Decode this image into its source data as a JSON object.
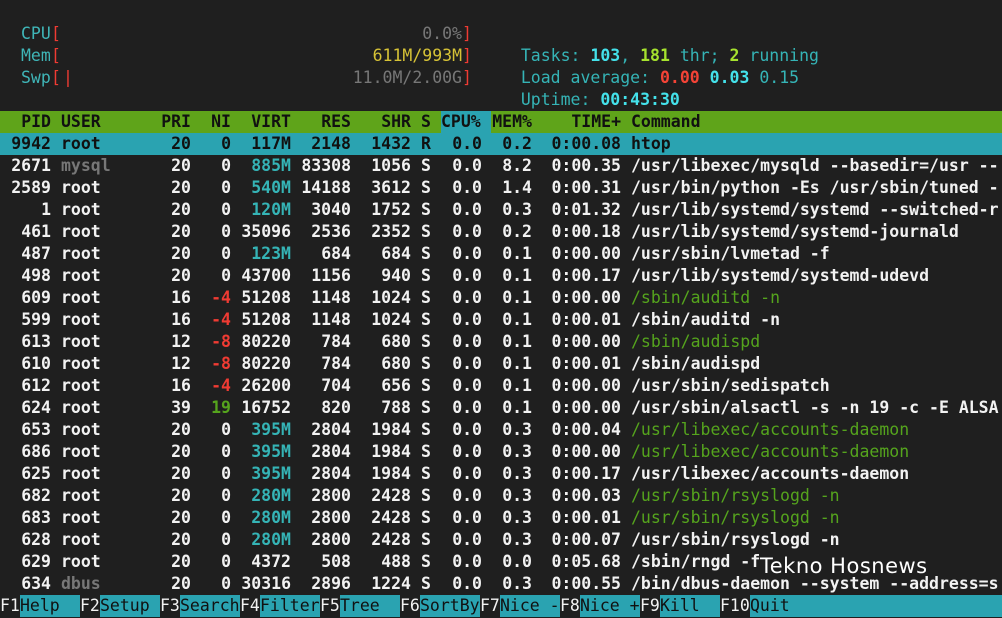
{
  "meters": {
    "cpu": {
      "label": "CPU",
      "bars": "",
      "value": "0.0%"
    },
    "mem": {
      "label": "Mem",
      "bars": "||||||||||||||||||||||||||||||||||||||",
      "value": "611M/993M"
    },
    "swp": {
      "label": "Swp",
      "bars": "|",
      "value": "11.0M/2.00G"
    }
  },
  "summary": {
    "tasks_label": "Tasks: ",
    "tasks": "103",
    "thr": "181",
    "thr_label": " thr; ",
    "running": "2",
    "running_label": " running",
    "load_label": "Load average: ",
    "load1": "0.00",
    "load5": "0.03",
    "load15": "0.15",
    "uptime_label": "Uptime: ",
    "uptime": "00:43:30"
  },
  "columns": [
    "PID",
    "USER",
    "PRI",
    "NI",
    "VIRT",
    "RES",
    "SHR",
    "S",
    "CPU%",
    "MEM%",
    "TIME+",
    "Command"
  ],
  "processes": [
    {
      "pid": "9942",
      "user": "root",
      "pri": "20",
      "ni": "0",
      "virt": "117M",
      "res": "2148",
      "shr": "1432",
      "s": "R",
      "cpu": "0.0",
      "mem": "0.2",
      "time": "0:00.08",
      "cmd": "htop"
    },
    {
      "pid": "2671",
      "user": "mysql",
      "pri": "20",
      "ni": "0",
      "virt": "885M",
      "res": "83308",
      "shr": "1056",
      "s": "S",
      "cpu": "0.0",
      "mem": "8.2",
      "time": "0:00.35",
      "cmd": "/usr/libexec/mysqld --basedir=/usr --"
    },
    {
      "pid": "2589",
      "user": "root",
      "pri": "20",
      "ni": "0",
      "virt": "540M",
      "res": "14188",
      "shr": "3612",
      "s": "S",
      "cpu": "0.0",
      "mem": "1.4",
      "time": "0:00.31",
      "cmd": "/usr/bin/python -Es /usr/sbin/tuned -"
    },
    {
      "pid": "1",
      "user": "root",
      "pri": "20",
      "ni": "0",
      "virt": "120M",
      "res": "3040",
      "shr": "1752",
      "s": "S",
      "cpu": "0.0",
      "mem": "0.3",
      "time": "0:01.32",
      "cmd": "/usr/lib/systemd/systemd --switched-r"
    },
    {
      "pid": "461",
      "user": "root",
      "pri": "20",
      "ni": "0",
      "virt": "35096",
      "res": "2536",
      "shr": "2352",
      "s": "S",
      "cpu": "0.0",
      "mem": "0.2",
      "time": "0:00.18",
      "cmd": "/usr/lib/systemd/systemd-journald"
    },
    {
      "pid": "487",
      "user": "root",
      "pri": "20",
      "ni": "0",
      "virt": "123M",
      "res": "684",
      "shr": "684",
      "s": "S",
      "cpu": "0.0",
      "mem": "0.1",
      "time": "0:00.00",
      "cmd": "/usr/sbin/lvmetad -f"
    },
    {
      "pid": "498",
      "user": "root",
      "pri": "20",
      "ni": "0",
      "virt": "43700",
      "res": "1156",
      "shr": "940",
      "s": "S",
      "cpu": "0.0",
      "mem": "0.1",
      "time": "0:00.17",
      "cmd": "/usr/lib/systemd/systemd-udevd"
    },
    {
      "pid": "609",
      "user": "root",
      "pri": "16",
      "ni": "-4",
      "virt": "51208",
      "res": "1148",
      "shr": "1024",
      "s": "S",
      "cpu": "0.0",
      "mem": "0.1",
      "time": "0:00.00",
      "cmd": "/sbin/auditd -n"
    },
    {
      "pid": "599",
      "user": "root",
      "pri": "16",
      "ni": "-4",
      "virt": "51208",
      "res": "1148",
      "shr": "1024",
      "s": "S",
      "cpu": "0.0",
      "mem": "0.1",
      "time": "0:00.01",
      "cmd": "/sbin/auditd -n"
    },
    {
      "pid": "613",
      "user": "root",
      "pri": "12",
      "ni": "-8",
      "virt": "80220",
      "res": "784",
      "shr": "680",
      "s": "S",
      "cpu": "0.0",
      "mem": "0.1",
      "time": "0:00.00",
      "cmd": "/sbin/audispd"
    },
    {
      "pid": "610",
      "user": "root",
      "pri": "12",
      "ni": "-8",
      "virt": "80220",
      "res": "784",
      "shr": "680",
      "s": "S",
      "cpu": "0.0",
      "mem": "0.1",
      "time": "0:00.01",
      "cmd": "/sbin/audispd"
    },
    {
      "pid": "612",
      "user": "root",
      "pri": "16",
      "ni": "-4",
      "virt": "26200",
      "res": "704",
      "shr": "656",
      "s": "S",
      "cpu": "0.0",
      "mem": "0.1",
      "time": "0:00.00",
      "cmd": "/usr/sbin/sedispatch"
    },
    {
      "pid": "624",
      "user": "root",
      "pri": "39",
      "ni": "19",
      "virt": "16752",
      "res": "820",
      "shr": "788",
      "s": "S",
      "cpu": "0.0",
      "mem": "0.1",
      "time": "0:00.00",
      "cmd": "/usr/sbin/alsactl -s -n 19 -c -E ALSA"
    },
    {
      "pid": "653",
      "user": "root",
      "pri": "20",
      "ni": "0",
      "virt": "395M",
      "res": "2804",
      "shr": "1984",
      "s": "S",
      "cpu": "0.0",
      "mem": "0.3",
      "time": "0:00.04",
      "cmd": "/usr/libexec/accounts-daemon"
    },
    {
      "pid": "686",
      "user": "root",
      "pri": "20",
      "ni": "0",
      "virt": "395M",
      "res": "2804",
      "shr": "1984",
      "s": "S",
      "cpu": "0.0",
      "mem": "0.3",
      "time": "0:00.00",
      "cmd": "/usr/libexec/accounts-daemon"
    },
    {
      "pid": "625",
      "user": "root",
      "pri": "20",
      "ni": "0",
      "virt": "395M",
      "res": "2804",
      "shr": "1984",
      "s": "S",
      "cpu": "0.0",
      "mem": "0.3",
      "time": "0:00.17",
      "cmd": "/usr/libexec/accounts-daemon"
    },
    {
      "pid": "682",
      "user": "root",
      "pri": "20",
      "ni": "0",
      "virt": "280M",
      "res": "2800",
      "shr": "2428",
      "s": "S",
      "cpu": "0.0",
      "mem": "0.3",
      "time": "0:00.03",
      "cmd": "/usr/sbin/rsyslogd -n"
    },
    {
      "pid": "683",
      "user": "root",
      "pri": "20",
      "ni": "0",
      "virt": "280M",
      "res": "2800",
      "shr": "2428",
      "s": "S",
      "cpu": "0.0",
      "mem": "0.3",
      "time": "0:00.01",
      "cmd": "/usr/sbin/rsyslogd -n"
    },
    {
      "pid": "628",
      "user": "root",
      "pri": "20",
      "ni": "0",
      "virt": "280M",
      "res": "2800",
      "shr": "2428",
      "s": "S",
      "cpu": "0.0",
      "mem": "0.3",
      "time": "0:00.07",
      "cmd": "/usr/sbin/rsyslogd -n"
    },
    {
      "pid": "629",
      "user": "root",
      "pri": "20",
      "ni": "0",
      "virt": "4372",
      "res": "508",
      "shr": "488",
      "s": "S",
      "cpu": "0.0",
      "mem": "0.0",
      "time": "0:05.68",
      "cmd": "/sbin/rngd -f"
    },
    {
      "pid": "634",
      "user": "dbus",
      "pri": "20",
      "ni": "0",
      "virt": "30316",
      "res": "2896",
      "shr": "1224",
      "s": "S",
      "cpu": "0.0",
      "mem": "0.3",
      "time": "0:00.55",
      "cmd": "/bin/dbus-daemon --system --address=s"
    }
  ],
  "fkeys": [
    {
      "key": "F1",
      "label": "Help  "
    },
    {
      "key": "F2",
      "label": "Setup "
    },
    {
      "key": "F3",
      "label": "Search"
    },
    {
      "key": "F4",
      "label": "Filter"
    },
    {
      "key": "F5",
      "label": "Tree  "
    },
    {
      "key": "F6",
      "label": "SortBy"
    },
    {
      "key": "F7",
      "label": "Nice -"
    },
    {
      "key": "F8",
      "label": "Nice +"
    },
    {
      "key": "F9",
      "label": "Kill  "
    },
    {
      "key": "F10",
      "label": "Quit"
    }
  ],
  "watermark": "Tekno Hosnews",
  "colors": {
    "background": "#1f1f1f",
    "header_bar": "#5fa41a",
    "selection": "#2aa3b1",
    "accent_cyan": "#35b4b6",
    "red": "#ef3b33"
  }
}
